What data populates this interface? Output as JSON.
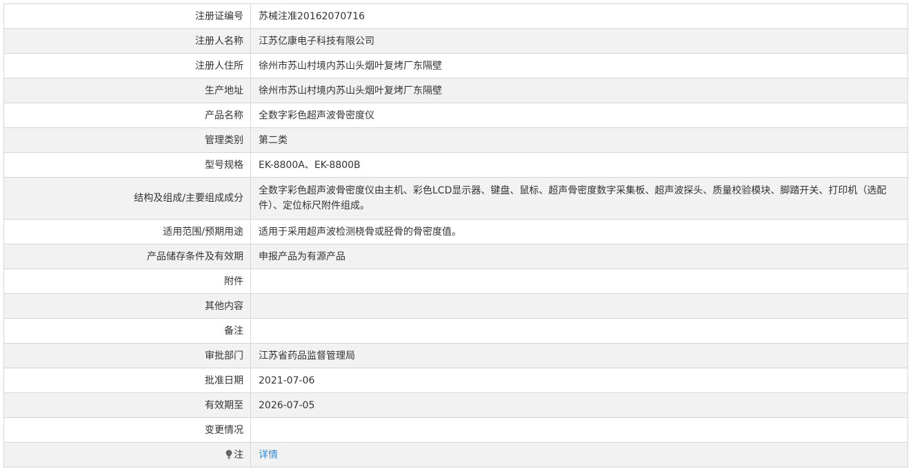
{
  "rows": [
    {
      "label": "注册证编号",
      "value": "苏械注准20162070716"
    },
    {
      "label": "注册人名称",
      "value": "江苏亿康电子科技有限公司"
    },
    {
      "label": "注册人住所",
      "value": "徐州市苏山村境内苏山头烟叶复烤厂东隔壁"
    },
    {
      "label": "生产地址",
      "value": "徐州市苏山村境内苏山头烟叶复烤厂东隔壁"
    },
    {
      "label": "产品名称",
      "value": "全数字彩色超声波骨密度仪"
    },
    {
      "label": "管理类别",
      "value": "第二类"
    },
    {
      "label": "型号规格",
      "value": "EK-8800A、EK-8800B"
    },
    {
      "label": "结构及组成/主要组成成分",
      "value": "全数字彩色超声波骨密度仪由主机、彩色LCD显示器、键盘、鼠标、超声骨密度数字采集板、超声波探头、质量校验模块、脚踏开关、打印机（选配件）、定位标尺附件组成。"
    },
    {
      "label": "适用范围/预期用途",
      "value": "适用于采用超声波检测桡骨或胫骨的骨密度值。"
    },
    {
      "label": "产品储存条件及有效期",
      "value": "申报产品为有源产品"
    },
    {
      "label": "附件",
      "value": ""
    },
    {
      "label": "其他内容",
      "value": ""
    },
    {
      "label": "备注",
      "value": ""
    },
    {
      "label": "审批部门",
      "value": "江苏省药品监督管理局"
    },
    {
      "label": "批准日期",
      "value": "2021-07-06"
    },
    {
      "label": "有效期至",
      "value": "2026-07-05"
    },
    {
      "label": "变更情况",
      "value": ""
    },
    {
      "label": "注",
      "value": "详情"
    }
  ],
  "colors": {
    "border": "#d6d6d6",
    "stripe": "#f2f2f2",
    "text": "#333333",
    "link": "#2f8ad6"
  },
  "icons": {
    "note_icon": "lightbulb-icon"
  }
}
